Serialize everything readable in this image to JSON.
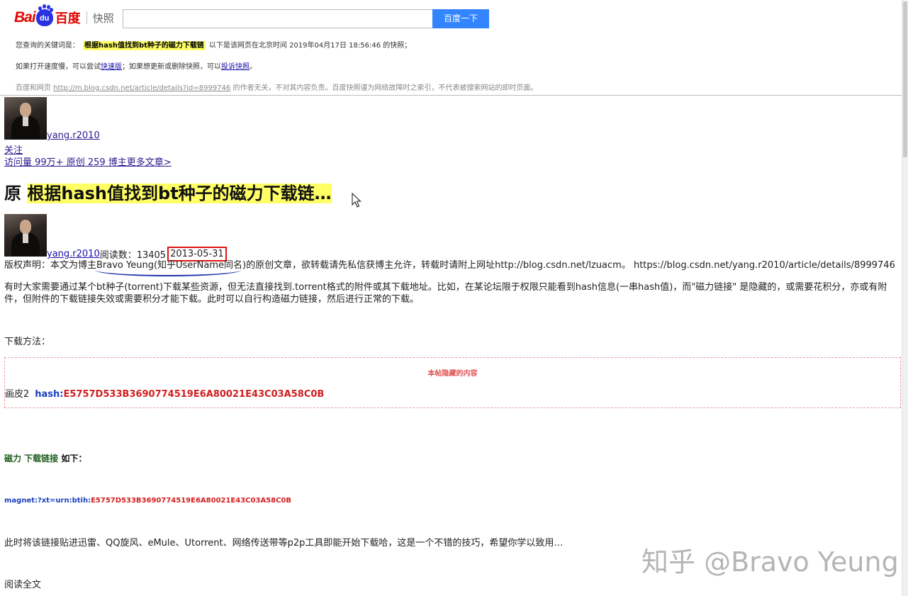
{
  "header": {
    "logo_bai": "Bai",
    "logo_du": "du",
    "logo_cn": "百度",
    "logo_kuaizhao": "快照",
    "search_value": "",
    "search_button": "百度一下",
    "line1_prefix": "您查询的关键词是：",
    "line1_keyword": "根据hash值找到bt种子的磁力下载链",
    "line1_suffix": "以下是该网页在北京时间 2019年04月17日 18:56:46 的快照；",
    "line2_a": "如果打开速度慢，可以尝试",
    "line2_link1": "快速版",
    "line2_b": "；如果想更新或删除快照，可以",
    "line2_link2": "投诉快照",
    "line2_c": "。",
    "line3_a": "百度和网页",
    "line3_url": "http://m.blog.csdn.net/article/details?id=8999746",
    "line3_b": "的作者无关，不对其内容负责。百度快照谨为网络故障时之索引，不代表被搜索网站的即时页面。"
  },
  "article": {
    "author_name": "yang.r2010",
    "follow": "关注",
    "stats": "访问量 99万+ 原创 259 博主更多文章>",
    "title_prefix": "原 ",
    "title_highlight": "根据hash值找到bt种子的磁力下载链…",
    "meta_author": "yang.r2010",
    "meta_reads": " 阅读数：13405",
    "meta_date": "2013-05-31",
    "copyright": "版权声明：本文为博主Bravo Yeung(知乎UserName同名)的原创文章，欲转载请先私信获博主允许，转载时请附上网址http://blog.csdn.net/lzuacm。 https://blog.csdn.net/yang.r2010/article/details/8999746",
    "intro": "有时大家需要通过某个bt种子(torrent)下载某些资源，但无法直接找到.torrent格式的附件或其下载地址。比如，在某论坛限于权限只能看到hash信息(一串hash值)，而\"磁力链接\" 是隐藏的，或需要花积分，亦或有附件，但附件的下载链接失效或需要积分才能下载。此时可以自行构造磁力链接，然后进行正常的下载。",
    "dl_method": "下载方法：",
    "hidden_label": "本帖隐藏的内容",
    "hidden_name": "画皮2",
    "hash_key": "hash:",
    "hash_value": "E5757D533B3690774519E6A80021E43C03A58C0B",
    "magnet_head_1": "磁力 下载链接",
    "magnet_head_2": " 如下：",
    "magnet_prefix": "magnet:?xt=urn:btih:",
    "magnet_hash": "E5757D533B3690774519E6A80021E43C03A58C0B",
    "tip": "此时将该链接贴进迅雷、QQ旋风、eMule、Utorrent、网络传送带等p2p工具即能开始下载哈，这是一个不错的技巧，希望你学以致用…",
    "read_all": "阅读全文"
  },
  "watermark": "知乎 @Bravo Yeung",
  "colors": {
    "baidu_red": "#e10601",
    "baidu_blue": "#2932e1",
    "search_button": "#3385ff",
    "keyword_highlight": "#ffff66",
    "date_box": "#dd1111",
    "hash_red": "#d11e1e",
    "hash_blue": "#1a3fbf"
  }
}
